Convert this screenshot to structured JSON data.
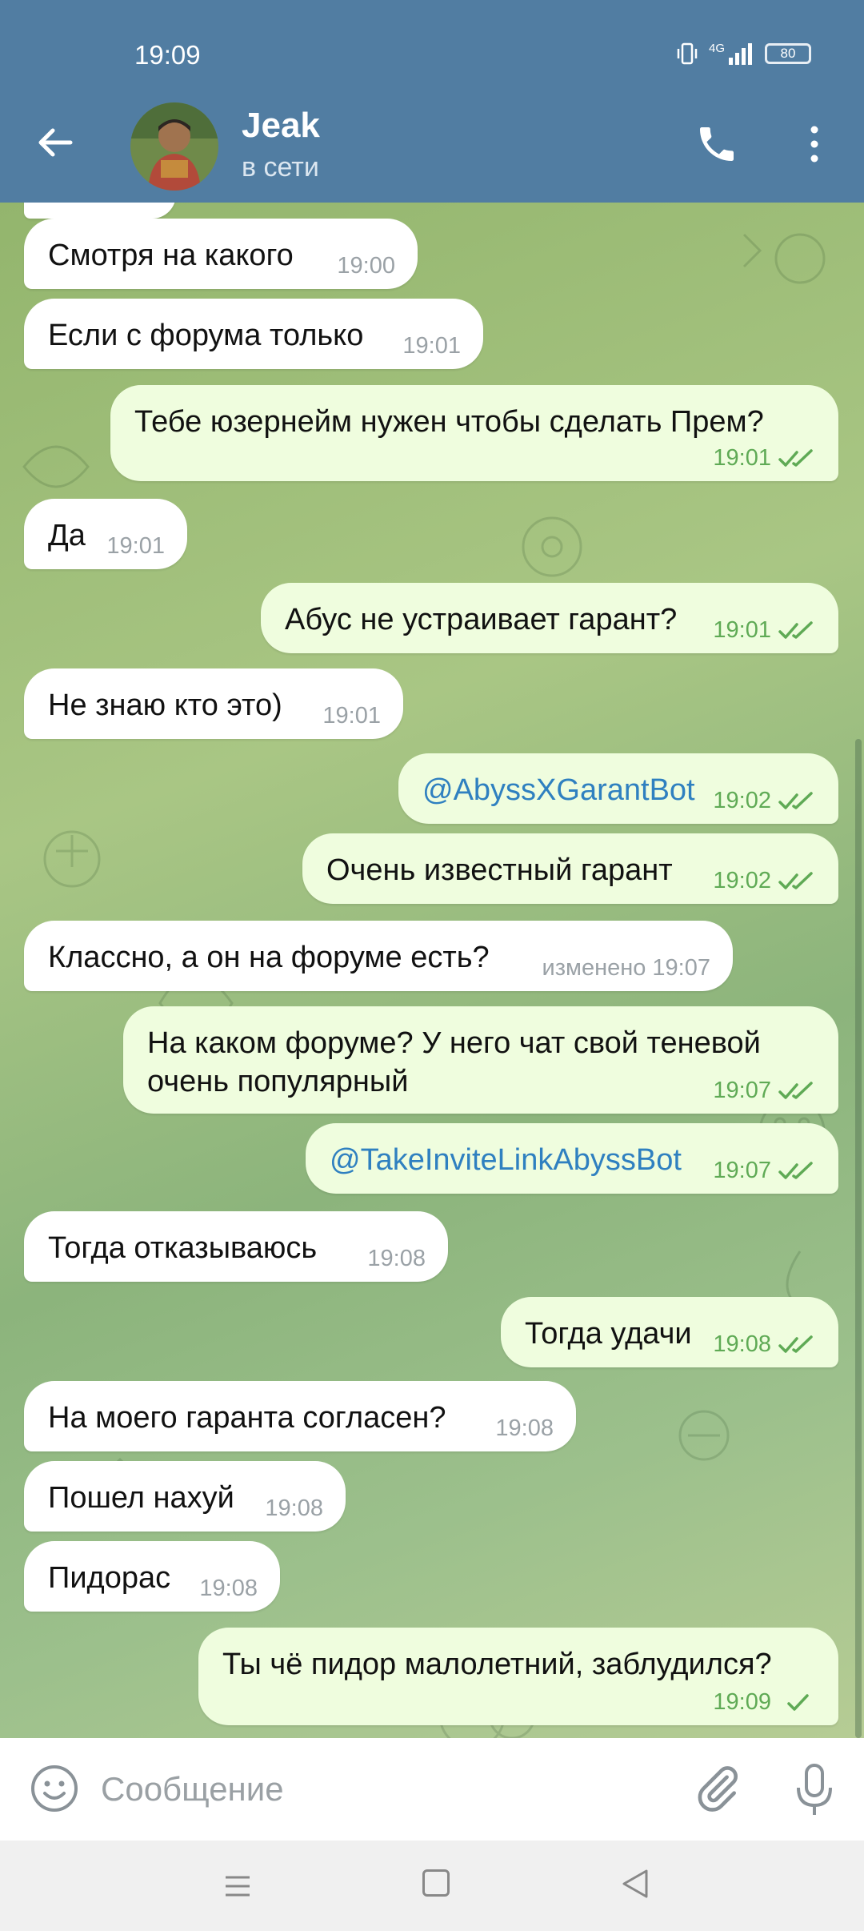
{
  "status_bar": {
    "time": "19:09",
    "network": "4G",
    "battery": "80"
  },
  "header": {
    "contact_name": "Jeak",
    "contact_status": "в сети"
  },
  "messages": [
    {
      "dir": "in",
      "text": "Смотря на какого",
      "time": "19:00"
    },
    {
      "dir": "in",
      "text": "Если с форума только",
      "time": "19:01"
    },
    {
      "dir": "out",
      "text": "Тебе юзернейм нужен чтобы сделать Прем?",
      "time": "19:01",
      "status": "read"
    },
    {
      "dir": "in",
      "text": "Да",
      "time": "19:01"
    },
    {
      "dir": "out",
      "text": "Абус не устраивает гарант?",
      "time": "19:01",
      "status": "read"
    },
    {
      "dir": "in",
      "text": "Не знаю кто это)",
      "time": "19:01"
    },
    {
      "dir": "out",
      "text": "@AbyssXGarantBot",
      "time": "19:02",
      "status": "read",
      "link": true
    },
    {
      "dir": "out",
      "text": "Очень известный гарант",
      "time": "19:02",
      "status": "read"
    },
    {
      "dir": "in",
      "text": "Классно, а он на форуме есть?",
      "time": "изменено 19:07"
    },
    {
      "dir": "out",
      "text": "На каком форуме? У него чат свой теневой",
      "text2": "очень популярный",
      "time": "19:07",
      "status": "read"
    },
    {
      "dir": "out",
      "text": "@TakeInviteLinkAbyssBot",
      "time": "19:07",
      "status": "read",
      "link": true
    },
    {
      "dir": "in",
      "text": "Тогда отказываюсь",
      "time": "19:08"
    },
    {
      "dir": "out",
      "text": "Тогда удачи",
      "time": "19:08",
      "status": "read"
    },
    {
      "dir": "in",
      "text": "На моего гаранта согласен?",
      "time": "19:08"
    },
    {
      "dir": "in",
      "text": "Пошел нахуй",
      "time": "19:08"
    },
    {
      "dir": "in",
      "text": "Пидорас",
      "time": "19:08"
    },
    {
      "dir": "out",
      "text": "Ты чё пидор малолетний, заблудился?",
      "time": "19:09",
      "status": "sent"
    }
  ],
  "input": {
    "placeholder": "Сообщение"
  },
  "icons": {
    "back": "arrow-left-icon",
    "call": "phone-icon",
    "menu": "more-vertical-icon",
    "emoji": "smile-icon",
    "attach": "paperclip-icon",
    "mic": "microphone-icon",
    "read": "double-check-icon",
    "sent": "single-check-icon"
  },
  "colors": {
    "header": "#517da2",
    "out_bubble": "#effdde",
    "in_bubble": "#ffffff",
    "link": "#2f80c0",
    "check": "#5faa55"
  }
}
